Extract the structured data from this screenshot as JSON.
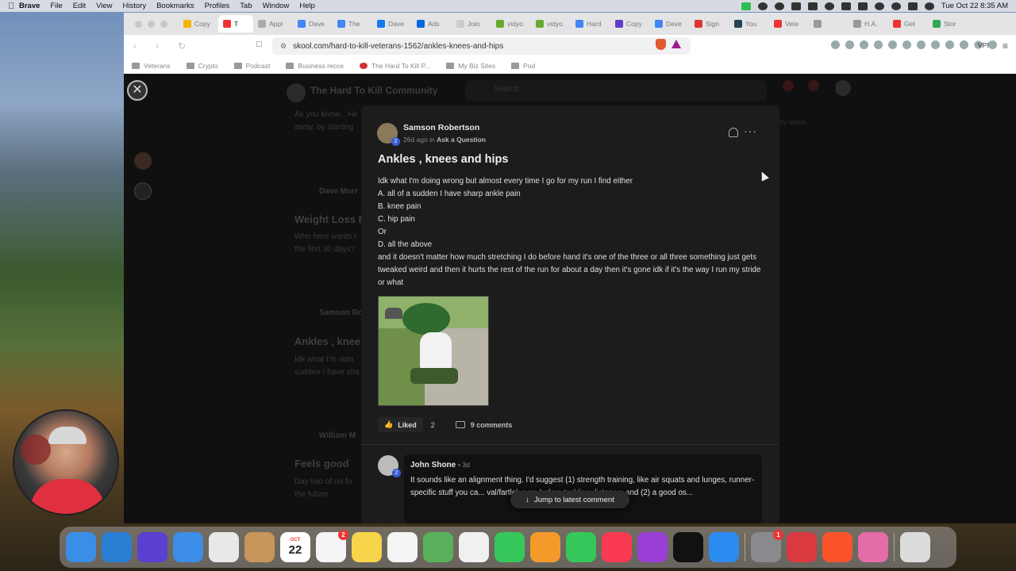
{
  "menubar": {
    "app": "Brave",
    "items": [
      "File",
      "Edit",
      "View",
      "History",
      "Bookmarks",
      "Profiles",
      "Tab",
      "Window",
      "Help"
    ],
    "clock": "Tue Oct 22  8:35 AM"
  },
  "tabs": [
    {
      "label": "Copy",
      "color": "#f4b400"
    },
    {
      "label": "T",
      "color": "#e33",
      "active": true
    },
    {
      "label": "Appl",
      "color": "#aaa"
    },
    {
      "label": "Dave",
      "color": "#4285f4"
    },
    {
      "label": "The",
      "color": "#4285f4"
    },
    {
      "label": "Dave",
      "color": "#1877f2"
    },
    {
      "label": "Ads",
      "color": "#0064e0"
    },
    {
      "label": "Join",
      "color": "#ccc"
    },
    {
      "label": "vidyo",
      "color": "#6a3"
    },
    {
      "label": "vidyo",
      "color": "#6a3"
    },
    {
      "label": "Hard",
      "color": "#4285f4"
    },
    {
      "label": "Copy",
      "color": "#5f3dc4"
    },
    {
      "label": "Dave",
      "color": "#4285f4"
    },
    {
      "label": "Sign",
      "color": "#d33"
    },
    {
      "label": "You",
      "color": "#245"
    },
    {
      "label": "Vete",
      "color": "#e33"
    },
    {
      "label": "",
      "color": "#999"
    },
    {
      "label": "H.A.",
      "color": "#999"
    },
    {
      "label": "Get",
      "color": "#e33"
    },
    {
      "label": "Stor",
      "color": "#34a853"
    }
  ],
  "url": "skool.com/hard-to-kill-veterans-1562/ankles-knees-and-hips",
  "vpn_label": "VPN",
  "bookmarks": [
    "Veterans",
    "Crypto",
    "Podcast",
    "Business recce",
    "The Hard To Kill P...",
    "My Biz Sites",
    "Pod"
  ],
  "background": {
    "community": "The Hard To Kill Community",
    "search": "Search",
    "posts": [
      {
        "snippet1": "As you know... He",
        "snippet2": "away, by starting"
      },
      {
        "author": "Dave Morr",
        "title": "Weight Loss B",
        "snippet1": "Who here wants t",
        "snippet2": "the first 30 days?"
      },
      {
        "author": "Samson Ro",
        "title": "Ankles , knee",
        "snippet1": "Idk what I'm doin",
        "snippet2": "sudden I have sha"
      },
      {
        "author": "William M",
        "title": "Feels good",
        "snippet1": "Day two of no fo",
        "snippet2": "the future."
      }
    ],
    "powered": "by skool"
  },
  "post": {
    "author": "Samson Robertson",
    "level": "2",
    "time": "26d ago in ",
    "category": "Ask a Question",
    "title": "Ankles , knees and hips",
    "body": [
      "Idk what I'm doing wrong but almost every time I go for my run I find either",
      "A. all of a sudden I have sharp ankle pain",
      "B. knee pain",
      "C. hip pain",
      "Or",
      "D. all the above",
      "and it doesn't matter how much stretching I do before hand it's one of the three or all three something just gets tweaked weird and then it hurts the rest of the run for about a day then it's gone idk if it's the way I run my stride or what"
    ],
    "like_label": "Liked",
    "like_count": "2",
    "comments_label": "9 comments"
  },
  "comment": {
    "author": "John Shone",
    "level": "2",
    "time": "• 3d",
    "text": "It sounds like an alignment thing. I'd suggest (1) strength training, like air squats and lunges, runner-specific stuff you ca... val/fartlek runs before tackling distance; and (2) a good os..."
  },
  "jump_label": "Jump to latest comment",
  "dock": [
    {
      "name": "finder",
      "color": "#3a8ee6"
    },
    {
      "name": "safari",
      "color": "#2a7fd4"
    },
    {
      "name": "siri",
      "color": "#5a3fd0"
    },
    {
      "name": "mail",
      "color": "#3b8de8"
    },
    {
      "name": "launchpad",
      "color": "#e8e8e8"
    },
    {
      "name": "contacts",
      "color": "#c8955a"
    },
    {
      "name": "calendar",
      "color": "#fff",
      "month": "OCT",
      "day": "22"
    },
    {
      "name": "reminders",
      "color": "#f5f5f5",
      "badge": "2"
    },
    {
      "name": "notes",
      "color": "#f7d44a"
    },
    {
      "name": "freeform",
      "color": "#f5f5f5"
    },
    {
      "name": "maps",
      "color": "#58b15a"
    },
    {
      "name": "photos",
      "color": "#f0f0f0"
    },
    {
      "name": "messages",
      "color": "#35c759"
    },
    {
      "name": "pages",
      "color": "#f39a2b"
    },
    {
      "name": "numbers",
      "color": "#35c759"
    },
    {
      "name": "music",
      "color": "#fa3a52"
    },
    {
      "name": "podcasts",
      "color": "#9a3fd6"
    },
    {
      "name": "tv",
      "color": "#111"
    },
    {
      "name": "app-store",
      "color": "#2a8cf0"
    },
    {
      "name": "system-settings",
      "color": "#8a8a8e",
      "badge": "1"
    },
    {
      "name": "expressvpn",
      "color": "#da3940"
    },
    {
      "name": "brave",
      "color": "#fb542b"
    },
    {
      "name": "screen-app",
      "color": "#e46ca8"
    },
    {
      "name": "trash",
      "color": "#dcdcdc"
    }
  ]
}
